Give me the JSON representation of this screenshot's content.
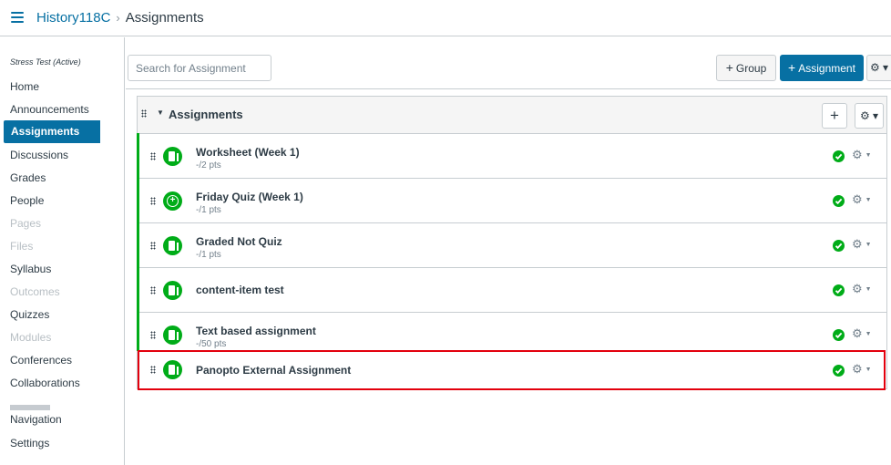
{
  "header": {
    "course": "History118C",
    "separator": "›",
    "current": "Assignments"
  },
  "course_nav": {
    "term": "Stress Test (Active)",
    "items": [
      {
        "label": "Home",
        "state": "normal"
      },
      {
        "label": "Announcements",
        "state": "normal"
      },
      {
        "label": "Assignments",
        "state": "active"
      },
      {
        "label": "Discussions",
        "state": "normal"
      },
      {
        "label": "Grades",
        "state": "normal"
      },
      {
        "label": "People",
        "state": "normal"
      },
      {
        "label": "Pages",
        "state": "disabled"
      },
      {
        "label": "Files",
        "state": "disabled"
      },
      {
        "label": "Syllabus",
        "state": "normal"
      },
      {
        "label": "Outcomes",
        "state": "disabled"
      },
      {
        "label": "Quizzes",
        "state": "normal"
      },
      {
        "label": "Modules",
        "state": "disabled"
      },
      {
        "label": "Conferences",
        "state": "normal"
      },
      {
        "label": "Collaborations",
        "state": "normal"
      },
      {
        "label": "Navigation",
        "state": "normal"
      },
      {
        "label": "Settings",
        "state": "normal"
      }
    ]
  },
  "toolbar": {
    "search_placeholder": "Search for Assignment",
    "group_button": "Group",
    "assignment_button": "Assignment",
    "plus_symbol": "+",
    "gear_symbol": "⚙ ▾"
  },
  "group": {
    "title": "Assignments",
    "add_symbol": "+",
    "gear_symbol": "⚙ ▾",
    "assignments": [
      {
        "title": "Worksheet (Week 1)",
        "points": "-/2 pts",
        "icon": "assignment-icon",
        "published": true
      },
      {
        "title": "Friday Quiz (Week 1)",
        "points": "-/1 pts",
        "icon": "quiz-icon",
        "published": true
      },
      {
        "title": "Graded Not Quiz",
        "points": "-/1 pts",
        "icon": "assignment-icon",
        "published": true
      },
      {
        "title": "content-item test",
        "points": "",
        "icon": "assignment-icon",
        "published": true
      },
      {
        "title": "Text based assignment",
        "points": "-/50 pts",
        "icon": "assignment-icon",
        "published": true
      },
      {
        "title": "Panopto External Assignment",
        "points": "",
        "icon": "assignment-icon",
        "published": true,
        "highlighted": true
      }
    ]
  },
  "colors": {
    "brand_blue": "#0770a3",
    "published_green": "#00ac18",
    "highlight_red": "#e3000d"
  }
}
